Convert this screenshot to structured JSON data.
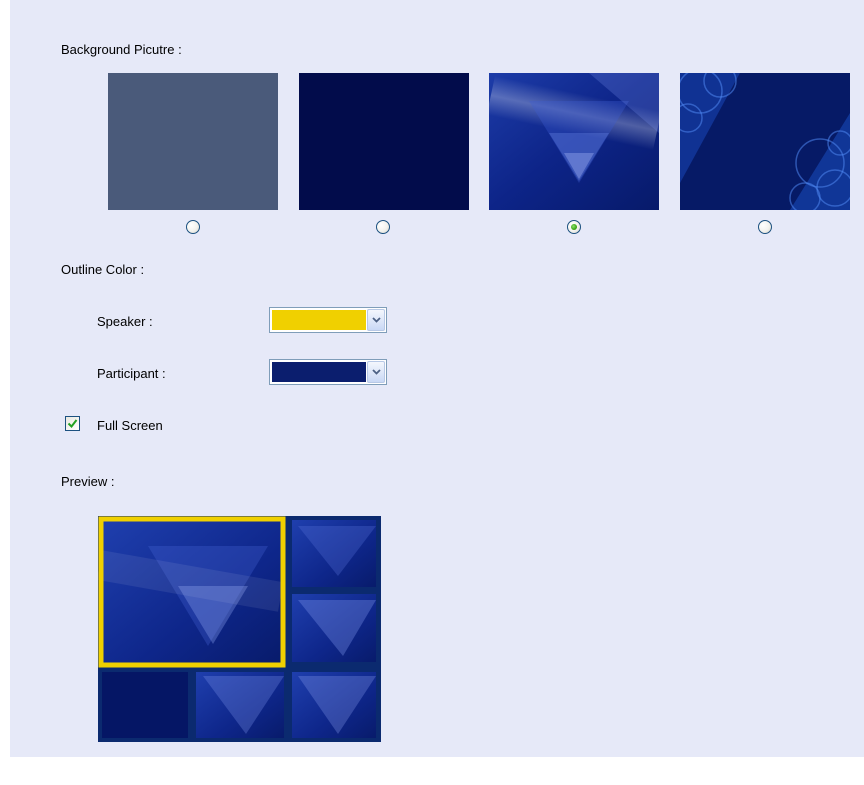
{
  "background_section": {
    "label": "Background Picutre :",
    "options": [
      {
        "style": "slate",
        "selected": false
      },
      {
        "style": "navy",
        "selected": false
      },
      {
        "style": "blue-triangles",
        "selected": true
      },
      {
        "style": "blue-circles",
        "selected": false
      }
    ]
  },
  "outline_section": {
    "label": "Outline Color :",
    "speaker": {
      "label": "Speaker :",
      "color": "#f0d000"
    },
    "participant": {
      "label": "Participant :",
      "color": "#0b1e6e"
    }
  },
  "full_screen": {
    "label": "Full Screen",
    "checked": true
  },
  "preview": {
    "label": "Preview :"
  }
}
